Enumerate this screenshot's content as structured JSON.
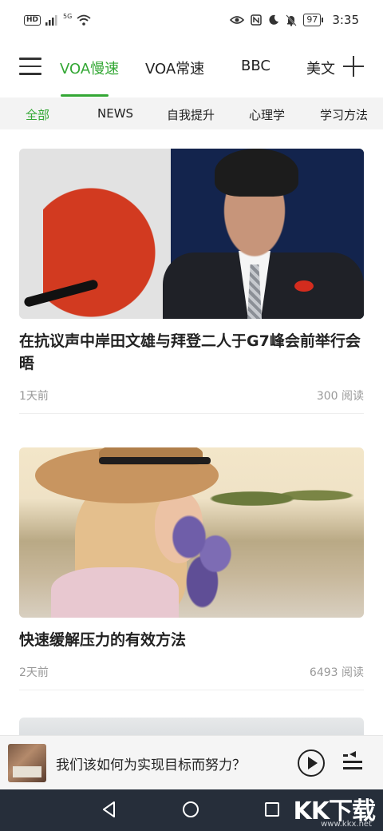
{
  "status_bar": {
    "left_badge": "HD",
    "signal_label": "5G",
    "battery": "97",
    "time": "3:35",
    "icons": [
      "eye-icon",
      "nfc-icon",
      "moon-icon",
      "bell-off-icon",
      "battery-icon",
      "wifi-icon",
      "signal-icon"
    ]
  },
  "top_nav": {
    "tabs": [
      {
        "label": "VOA慢速",
        "active": true
      },
      {
        "label": "VOA常速",
        "active": false
      },
      {
        "label": "BBC",
        "active": false
      },
      {
        "label": "美文",
        "active": false
      }
    ],
    "accent_color": "#33a734"
  },
  "categories": [
    {
      "label": "全部",
      "active": true
    },
    {
      "label": "NEWS",
      "active": false
    },
    {
      "label": "自我提升",
      "active": false
    },
    {
      "label": "心理学",
      "active": false
    },
    {
      "label": "学习方法",
      "active": false
    }
  ],
  "articles": [
    {
      "title": "在抗议声中岸田文雄与拜登二人于G7峰会前举行会晤",
      "time": "1天前",
      "reads": "300 阅读"
    },
    {
      "title": "快速缓解压力的有效方法",
      "time": "2天前",
      "reads": "6493 阅读"
    }
  ],
  "mini_player": {
    "title": "我们该如何为实现目标而努力？"
  },
  "watermark": {
    "text": "KK下载",
    "url": "www.kkx.net"
  }
}
